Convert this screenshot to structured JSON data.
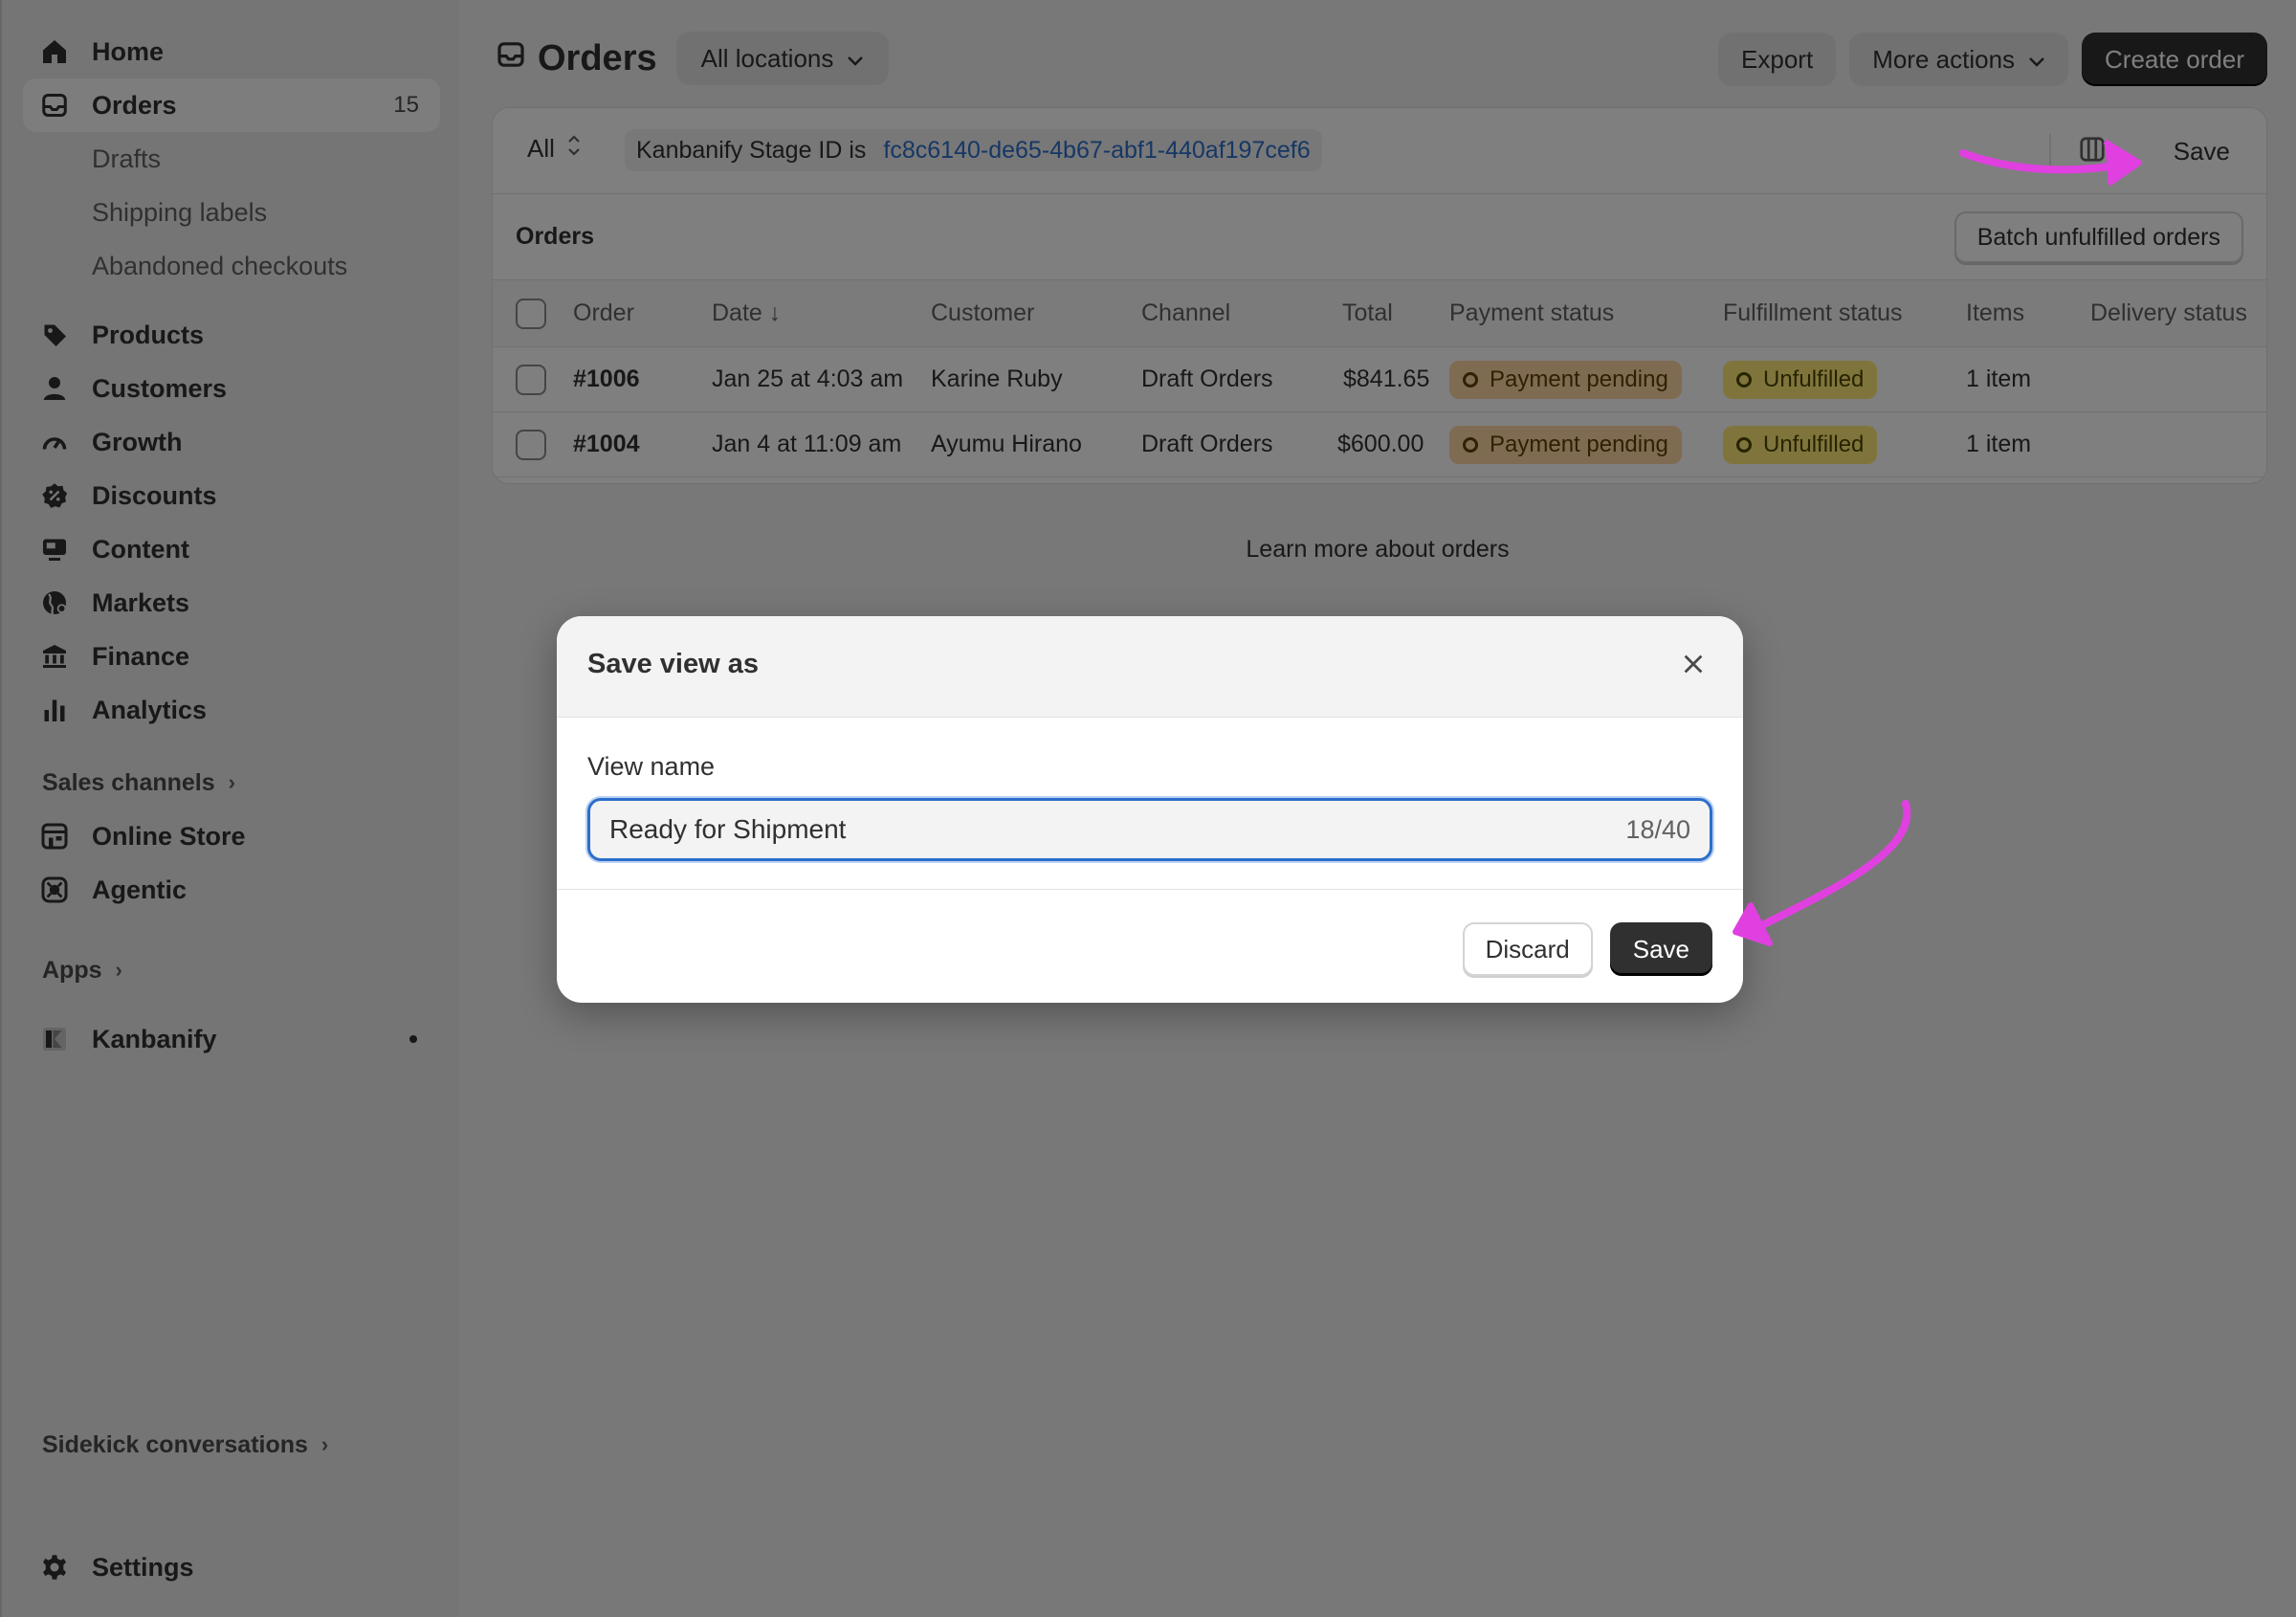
{
  "sidebar": {
    "nav": [
      {
        "label": "Home",
        "icon": "home-icon"
      },
      {
        "label": "Orders",
        "icon": "inbox-icon",
        "count": "15"
      },
      {
        "label": "Products",
        "icon": "tag-icon"
      },
      {
        "label": "Customers",
        "icon": "person-icon"
      },
      {
        "label": "Growth",
        "icon": "gauge-icon"
      },
      {
        "label": "Discounts",
        "icon": "discount-icon"
      },
      {
        "label": "Content",
        "icon": "monitor-icon"
      },
      {
        "label": "Markets",
        "icon": "globe-icon"
      },
      {
        "label": "Finance",
        "icon": "bank-icon"
      },
      {
        "label": "Analytics",
        "icon": "bar-chart-icon"
      }
    ],
    "orders_sub": [
      "Drafts",
      "Shipping labels",
      "Abandoned checkouts"
    ],
    "sales_channels_label": "Sales channels",
    "channels": [
      {
        "label": "Online Store",
        "icon": "store-icon"
      },
      {
        "label": "Agentic",
        "icon": "agentic-icon"
      }
    ],
    "apps_label": "Apps",
    "apps": [
      {
        "label": "Kanbanify",
        "icon": "kanbanify-icon"
      }
    ],
    "sidekick_label": "Sidekick conversations",
    "settings_label": "Settings"
  },
  "header": {
    "title": "Orders",
    "location_label": "All locations",
    "export_label": "Export",
    "more_actions_label": "More actions",
    "create_order_label": "Create order"
  },
  "filters": {
    "tab_label": "All",
    "chip_key": "Kanbanify Stage ID is",
    "chip_value": "fc8c6140-de65-4b67-abf1-440af197cef6",
    "save_label": "Save"
  },
  "orders_section": {
    "label": "Orders",
    "batch_label": "Batch unfulfilled orders"
  },
  "table": {
    "headers": {
      "order": "Order",
      "date": "Date ↓",
      "customer": "Customer",
      "channel": "Channel",
      "total": "Total",
      "payment": "Payment status",
      "fulfillment": "Fulfillment status",
      "items": "Items",
      "delivery": "Delivery status"
    },
    "rows": [
      {
        "order": "#1006",
        "date": "Jan 25 at 4:03 am",
        "customer": "Karine Ruby",
        "channel": "Draft Orders",
        "total": "$841.65",
        "payment": "Payment pending",
        "fulfillment": "Unfulfilled",
        "items": "1 item"
      },
      {
        "order": "#1004",
        "date": "Jan 4 at 11:09 am",
        "customer": "Ayumu Hirano",
        "channel": "Draft Orders",
        "total": "$600.00",
        "payment": "Payment pending",
        "fulfillment": "Unfulfilled",
        "items": "1 item"
      }
    ]
  },
  "learn_more": "Learn more about orders",
  "modal": {
    "title": "Save view as",
    "field_label": "View name",
    "field_value": "Ready for Shipment",
    "char_count": "18/40",
    "discard_label": "Discard",
    "save_label": "Save"
  },
  "colors": {
    "accent_blue": "#2c6ecb",
    "annotation_pink": "#e040e0",
    "payment_badge": "#ffd6a4",
    "fulfillment_badge": "#ffeb78"
  }
}
